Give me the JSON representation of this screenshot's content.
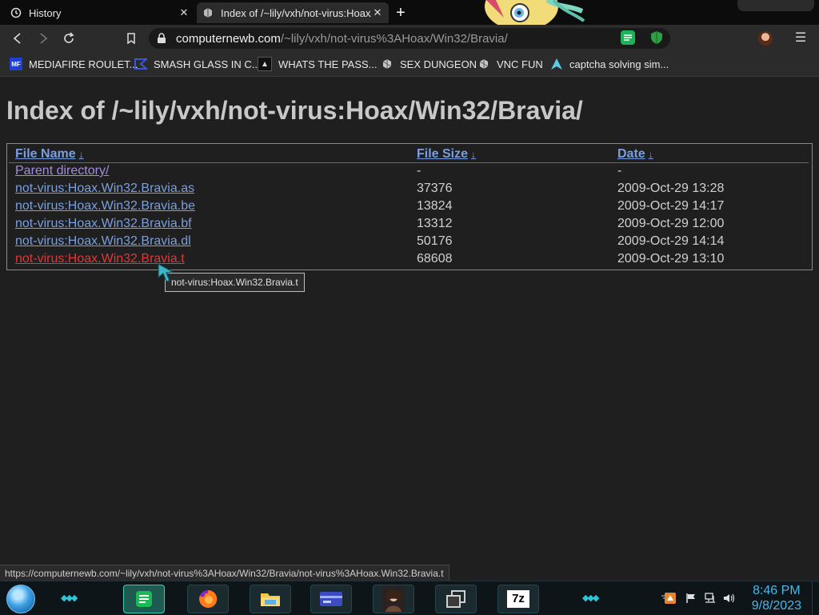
{
  "tabs": [
    {
      "label": "History",
      "icon": "history-icon"
    },
    {
      "label": "Index of /~lily/vxh/not-virus:Hoax/",
      "icon": "favicon-icon"
    }
  ],
  "address_bar": {
    "host": "computernewb.com",
    "path": "/~lily/vxh/not-virus%3AHoax/Win32/Bravia/"
  },
  "bookmarks": [
    {
      "label": "MEDIAFIRE ROULET...",
      "icon": "mediafire-icon",
      "badge": "MF"
    },
    {
      "label": "SMASH GLASS IN C...",
      "icon": "code-icon"
    },
    {
      "label": "WHATS THE PASS...",
      "icon": "terminal-icon"
    },
    {
      "label": "SEX DUNGEON",
      "icon": "vnc-icon"
    },
    {
      "label": "VNC FUN",
      "icon": "vnc-icon"
    },
    {
      "label": "captcha solving sim...",
      "icon": "arch-icon"
    }
  ],
  "page": {
    "title": "Index of /~lily/vxh/not-virus:Hoax/Win32/Bravia/",
    "headers": {
      "name": "File Name",
      "size": "File Size",
      "date": "Date",
      "sort": "↓"
    },
    "rows": [
      {
        "name": "Parent directory/",
        "size": "-",
        "date": "-"
      },
      {
        "name": "not-virus:Hoax.Win32.Bravia.as",
        "size": "37376",
        "date": "2009-Oct-29 13:28"
      },
      {
        "name": "not-virus:Hoax.Win32.Bravia.be",
        "size": "13824",
        "date": "2009-Oct-29 14:17"
      },
      {
        "name": "not-virus:Hoax.Win32.Bravia.bf",
        "size": "13312",
        "date": "2009-Oct-29 12:00"
      },
      {
        "name": "not-virus:Hoax.Win32.Bravia.dl",
        "size": "50176",
        "date": "2009-Oct-29 14:14"
      },
      {
        "name": "not-virus:Hoax.Win32.Bravia.t",
        "size": "68608",
        "date": "2009-Oct-29 13:10"
      }
    ],
    "tooltip": "not-virus:Hoax.Win32.Bravia.t"
  },
  "status_url": "https://computernewb.com/~lily/vxh/not-virus%3AHoax/Win32/Bravia/not-virus%3AHoax.Win32.Bravia.t",
  "taskbar": {
    "apps": [
      "notes-app-icon",
      "firefox-icon",
      "file-explorer-icon",
      "card-app-icon",
      "portrait-app-icon",
      "windows-app-icon",
      "7zip-icon"
    ],
    "seven_zip_label": "7z",
    "time": "8:46 PM",
    "date": "9/8/2023"
  },
  "colors": {
    "link": "#7a9fe0",
    "visited_link": "#a58be0",
    "hover_link": "#e03838",
    "clock": "#4ab8e8",
    "taskbar_accent": "#2ec6d6"
  }
}
